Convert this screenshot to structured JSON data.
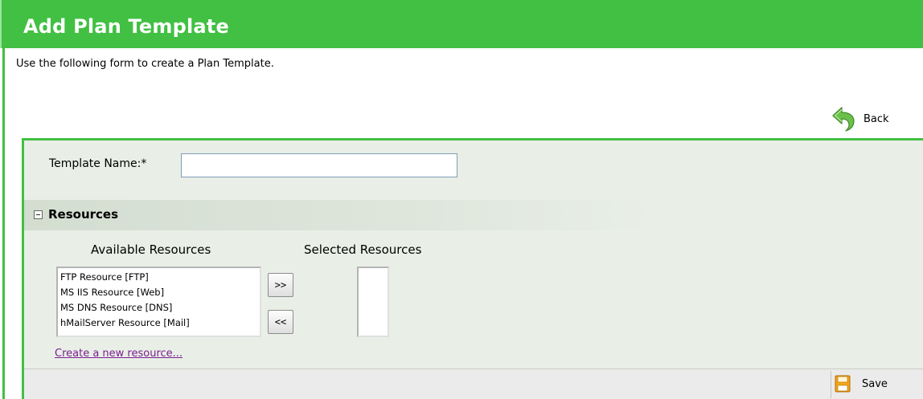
{
  "header": {
    "title": "Add Plan Template"
  },
  "subtitle": "Use the following form to create a Plan Template.",
  "back": {
    "label": "Back",
    "icon": "back-arrow-icon"
  },
  "form": {
    "template_name_label": "Template Name:*",
    "template_name_value": "",
    "section_title": "Resources",
    "available_label": "Available Resources",
    "selected_label": "Selected Resources",
    "available_resources": [
      "FTP Resource [FTP]",
      "MS IIS Resource [Web]",
      "MS DNS Resource [DNS]",
      "hMailServer Resource [Mail]"
    ],
    "selected_resources": [],
    "add_button": ">>",
    "remove_button": "<<",
    "create_link": "Create a new resource..."
  },
  "footer": {
    "save_label": "Save",
    "save_icon": "floppy-disk-icon"
  },
  "colors": {
    "header_bg": "#42c043",
    "panel_bg": "#e9efe7",
    "link_visited": "#7b1f8f"
  }
}
